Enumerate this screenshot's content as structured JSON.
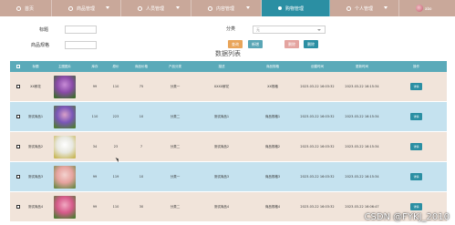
{
  "nav": {
    "items": [
      {
        "label": "首页",
        "active": false
      },
      {
        "label": "商品管理",
        "active": false
      },
      {
        "label": "人员管理",
        "active": false
      },
      {
        "label": "内容管理",
        "active": false
      },
      {
        "label": "购物管理",
        "active": true
      },
      {
        "label": "个人管理",
        "active": false
      }
    ],
    "user_name": "abo"
  },
  "search": {
    "title_label": "标题",
    "category_label": "分类",
    "category_value": "无",
    "spec_label": "商品规格",
    "search_btn": "查询",
    "add_btn": "新增",
    "delete_btn": "删除",
    "batch_btn": "删除"
  },
  "list_title": "数据列表",
  "table": {
    "headers": [
      "",
      "标题",
      "主图图片",
      "库存",
      "原价",
      "商品价格",
      "产品分类",
      "描述",
      "商品规格",
      "创建时间",
      "更新时间",
      "操作"
    ],
    "rows": [
      {
        "title": "XX鲜花",
        "stock": "99",
        "original": "110",
        "price": "75",
        "category": "分类一",
        "desc": "XXXX鲜花",
        "spec": "XX规格",
        "created": "2023-03-22 16:03:32",
        "updated": "2023-03-22 16:15:34",
        "action": "详情",
        "thumb": [
          "#8a4aa8",
          "#c78bd6",
          "#3d6b2d"
        ]
      },
      {
        "title": "测试商品1",
        "stock": "110",
        "original": "223",
        "price": "10",
        "category": "分类二",
        "desc": "测试商品1",
        "spec": "商品规格1",
        "created": "2023-03-22 16:03:32",
        "updated": "2023-03-22 16:15:34",
        "action": "详情",
        "thumb": [
          "#7a56b8",
          "#d9a0c9",
          "#4f7a35"
        ]
      },
      {
        "title": "测试商品2",
        "stock": "34",
        "original": "23",
        "price": "7",
        "category": "分类二",
        "desc": "测试商品2",
        "spec": "商品规格2",
        "created": "2023-03-22 16:03:32",
        "updated": "2023-03-22 16:15:34",
        "action": "详情",
        "thumb": [
          "#e8e8e0",
          "#ffffff",
          "#c9b85a"
        ]
      },
      {
        "title": "测试商品3",
        "stock": "99",
        "original": "119",
        "price": "10",
        "category": "分类一",
        "desc": "测试商品3",
        "spec": "商品规格3",
        "created": "2023-03-22 16:03:32",
        "updated": "2023-03-22 16:15:34",
        "action": "详情",
        "thumb": [
          "#e6a39f",
          "#f3d2cf",
          "#6f8a4a"
        ]
      },
      {
        "title": "测试商品4",
        "stock": "99",
        "original": "110",
        "price": "30",
        "category": "分类二",
        "desc": "测试商品4",
        "spec": "商品规格4",
        "created": "2023-03-22 16:03:32",
        "updated": "2023-03-22 16:06:47",
        "action": "详情",
        "thumb": [
          "#d65a8a",
          "#f1a9c2",
          "#4f7a35"
        ]
      }
    ]
  },
  "watermark": "CSDN @FYKJ_2010",
  "colors": {
    "nav_bg": "#c9a89a",
    "nav_active": "#2b8fa3",
    "header_bg": "#5aaab9",
    "row_odd": "#f1e4da",
    "row_even": "#c5e2ef"
  }
}
